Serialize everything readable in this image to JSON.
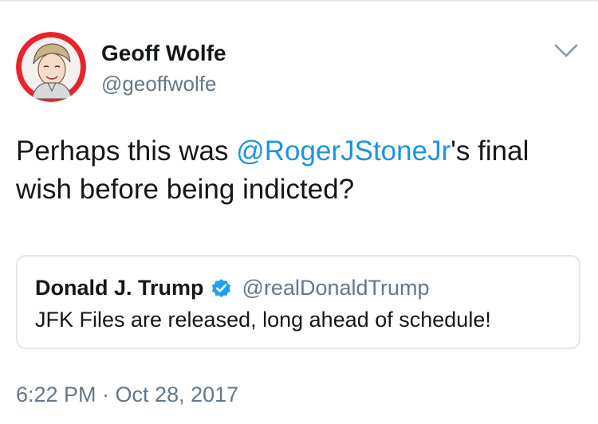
{
  "tweet": {
    "author_name": "Geoff Wolfe",
    "author_handle": "@geoffwolfe",
    "text_before": "Perhaps this was ",
    "mention": "@RogerJStoneJr",
    "text_after": "'s final wish before being indicted?",
    "timestamp": "6:22 PM · Oct 28, 2017"
  },
  "quoted_tweet": {
    "author_name": "Donald J. Trump",
    "author_handle": "@realDonaldTrump",
    "text": "JFK Files are released, long ahead of schedule!",
    "verified": true
  },
  "icons": {
    "menu": "chevron-down-icon",
    "verified": "verified-badge-icon"
  },
  "colors": {
    "text": "#14171a",
    "secondary": "#657786",
    "link": "#1b95e0",
    "border": "#e1e8ed",
    "avatar_ring": "#e8232a"
  }
}
